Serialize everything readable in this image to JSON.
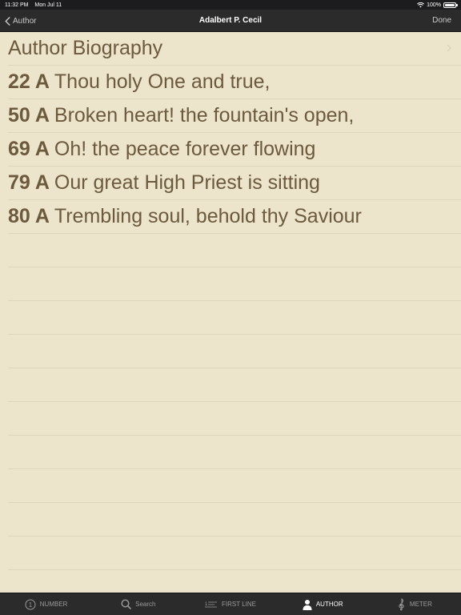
{
  "status_bar": {
    "time": "11:32 PM",
    "date": "Mon Jul 11",
    "battery": "100%"
  },
  "nav": {
    "back_label": "Author",
    "title": "Adalbert P. Cecil",
    "done_label": "Done"
  },
  "content": {
    "bio_label": "Author Biography",
    "hymns": [
      {
        "number": "22 A",
        "title": "Thou holy One and true,"
      },
      {
        "number": "50 A",
        "title": "Broken heart! the fountain's open,"
      },
      {
        "number": "69 A",
        "title": "Oh! the peace forever flowing"
      },
      {
        "number": "79 A",
        "title": "Our great High Priest is sitting"
      },
      {
        "number": "80 A",
        "title": "Trembling soul, behold thy Saviour"
      }
    ]
  },
  "tabs": [
    {
      "label": "NUMBER",
      "icon": "number-circle-icon",
      "active": false
    },
    {
      "label": "Search",
      "icon": "search-icon",
      "active": false
    },
    {
      "label": "FIRST LINE",
      "icon": "first-line-icon",
      "active": false
    },
    {
      "label": "AUTHOR",
      "icon": "person-icon",
      "active": true
    },
    {
      "label": "METER",
      "icon": "treble-clef-icon",
      "active": false
    }
  ],
  "colors": {
    "background": "#ECE4CB",
    "text": "#6b5a3e",
    "bar": "#2b2b2b"
  }
}
